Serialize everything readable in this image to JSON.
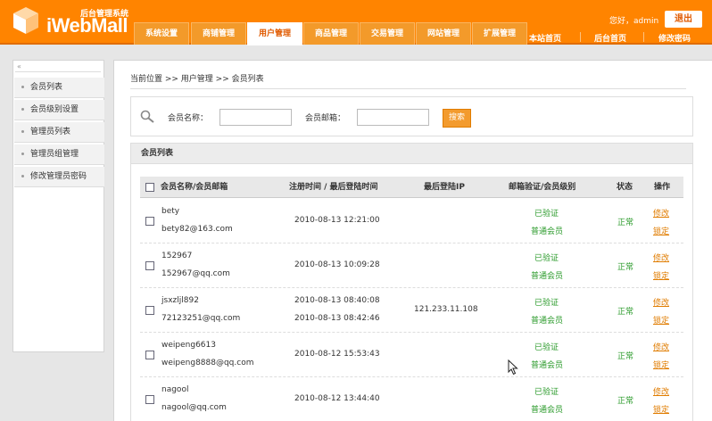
{
  "header": {
    "logo_subtitle": "后台管理系统",
    "logo_name": "iWebMall",
    "greeting": "您好，admin",
    "logout_label": "退出",
    "tabs": [
      {
        "label": "系统设置"
      },
      {
        "label": "商铺管理"
      },
      {
        "label": "用户管理",
        "active": true
      },
      {
        "label": "商品管理"
      },
      {
        "label": "交易管理"
      },
      {
        "label": "网站管理"
      },
      {
        "label": "扩展管理"
      }
    ],
    "links": [
      {
        "label": "本站首页"
      },
      {
        "label": "后台首页"
      },
      {
        "label": "修改密码"
      }
    ]
  },
  "sidebar": {
    "collapse_glyph": "«",
    "items": [
      {
        "label": "会员列表"
      },
      {
        "label": "会员级别设置"
      },
      {
        "label": "管理员列表"
      },
      {
        "label": "管理员组管理"
      },
      {
        "label": "修改管理员密码"
      }
    ]
  },
  "breadcrumb": "当前位置 >> 用户管理 >> 会员列表",
  "search": {
    "name_label": "会员名称：",
    "name_value": "",
    "email_label": "会员邮箱：",
    "email_value": "",
    "button_label": "搜索"
  },
  "panel_title": "会员列表",
  "table": {
    "headers": {
      "name": "会员名称/会员邮箱",
      "time": "注册时间 / 最后登陆时间",
      "ip": "最后登陆IP",
      "verify": "邮箱验证/会员级别",
      "status": "状态",
      "action": "操作"
    },
    "rows": [
      {
        "name": "bety",
        "email": "bety82@163.com",
        "reg_time": "2010-08-13 12:21:00",
        "last_time": "",
        "ip": "",
        "verify": "已验证",
        "level": "普通会员",
        "status": "正常",
        "edit": "修改",
        "lock": "锁定"
      },
      {
        "name": "152967",
        "email": "152967@qq.com",
        "reg_time": "2010-08-13 10:09:28",
        "last_time": "",
        "ip": "",
        "verify": "已验证",
        "level": "普通会员",
        "status": "正常",
        "edit": "修改",
        "lock": "锁定"
      },
      {
        "name": "jsxzljl892",
        "email": "72123251@qq.com",
        "reg_time": "2010-08-13 08:40:08",
        "last_time": "2010-08-13 08:42:46",
        "ip": "121.233.11.108",
        "verify": "已验证",
        "level": "普通会员",
        "status": "正常",
        "edit": "修改",
        "lock": "锁定"
      },
      {
        "name": "weipeng6613",
        "email": "weipeng8888@qq.com",
        "reg_time": "2010-08-12 15:53:43",
        "last_time": "",
        "ip": "",
        "verify": "已验证",
        "level": "普通会员",
        "status": "正常",
        "edit": "修改",
        "lock": "锁定"
      },
      {
        "name": "nagool",
        "email": "nagool@qq.com",
        "reg_time": "2010-08-12 13:44:40",
        "last_time": "",
        "ip": "",
        "verify": "已验证",
        "level": "普通会员",
        "status": "正常",
        "edit": "修改",
        "lock": "锁定"
      }
    ]
  },
  "colors": {
    "brand_orange": "#ff8400",
    "status_green": "#2a9a2a",
    "link_orange": "#e07c00"
  }
}
